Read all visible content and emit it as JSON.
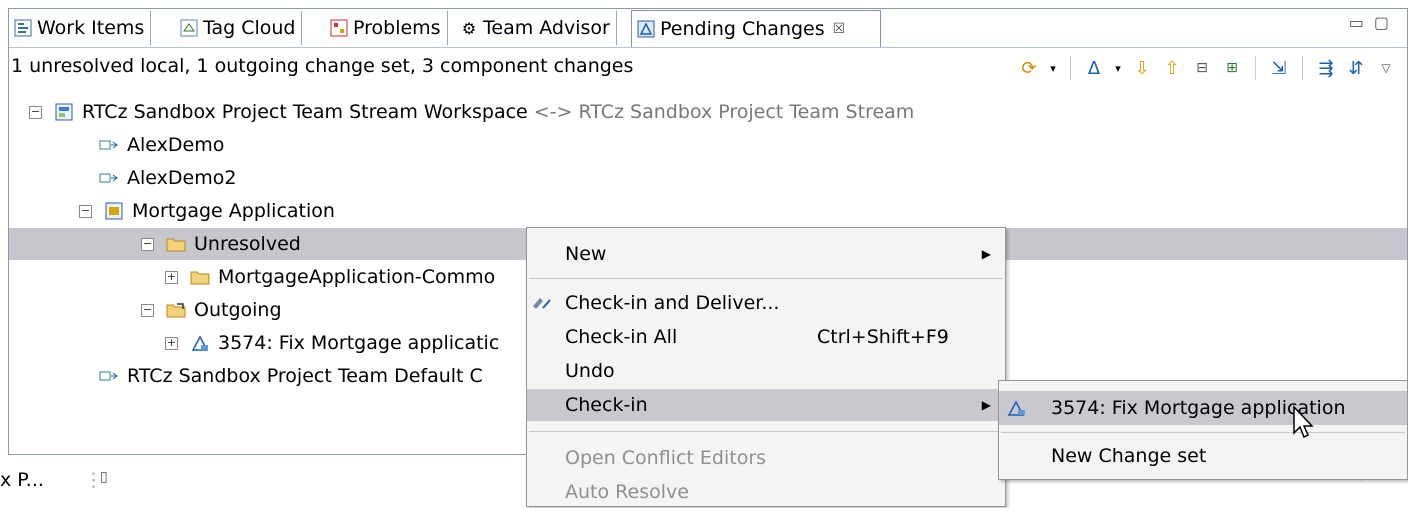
{
  "tabs": [
    {
      "label": "Work Items",
      "icon": "work-items-icon"
    },
    {
      "label": "Tag Cloud",
      "icon": "tag-cloud-icon"
    },
    {
      "label": "Problems",
      "icon": "problems-icon"
    },
    {
      "label": "Team Advisor",
      "icon": "gear-icon"
    },
    {
      "label": "Pending Changes",
      "icon": "pending-changes-icon",
      "close": "☒"
    }
  ],
  "status": {
    "text": "1 unresolved local, 1 outgoing change set, 3 component changes"
  },
  "tree": {
    "workspace": {
      "label": "RTCz Sandbox Project Team Stream Workspace",
      "suffix": "<-> RTCz Sandbox Project Team Stream"
    },
    "comp1": "AlexDemo",
    "comp2": "AlexDemo2",
    "comp3": "Mortgage Application",
    "unresolved": "Unresolved",
    "unresolved_child": "MortgageApplication-Commo",
    "outgoing": "Outgoing",
    "outgoing_child": "3574: Fix Mortgage applicatic",
    "comp4": "RTCz Sandbox Project Team Default C"
  },
  "menu": {
    "new": "New",
    "checkin_deliver": "Check-in and Deliver...",
    "checkin_all": "Check-in All",
    "checkin_all_accel": "Ctrl+Shift+F9",
    "undo": "Undo",
    "checkin": "Check-in",
    "open_conflict": "Open Conflict Editors",
    "auto_resolve": "Auto Resolve"
  },
  "submenu": {
    "changeset": "3574: Fix Mortgage application",
    "new_changeset": "New Change set"
  },
  "bottom": {
    "text": "x P..."
  },
  "colors": {
    "selection": "#c6c6cc",
    "menu_bg": "#f4f4f4",
    "menu_highlight": "#c8c8cf"
  }
}
